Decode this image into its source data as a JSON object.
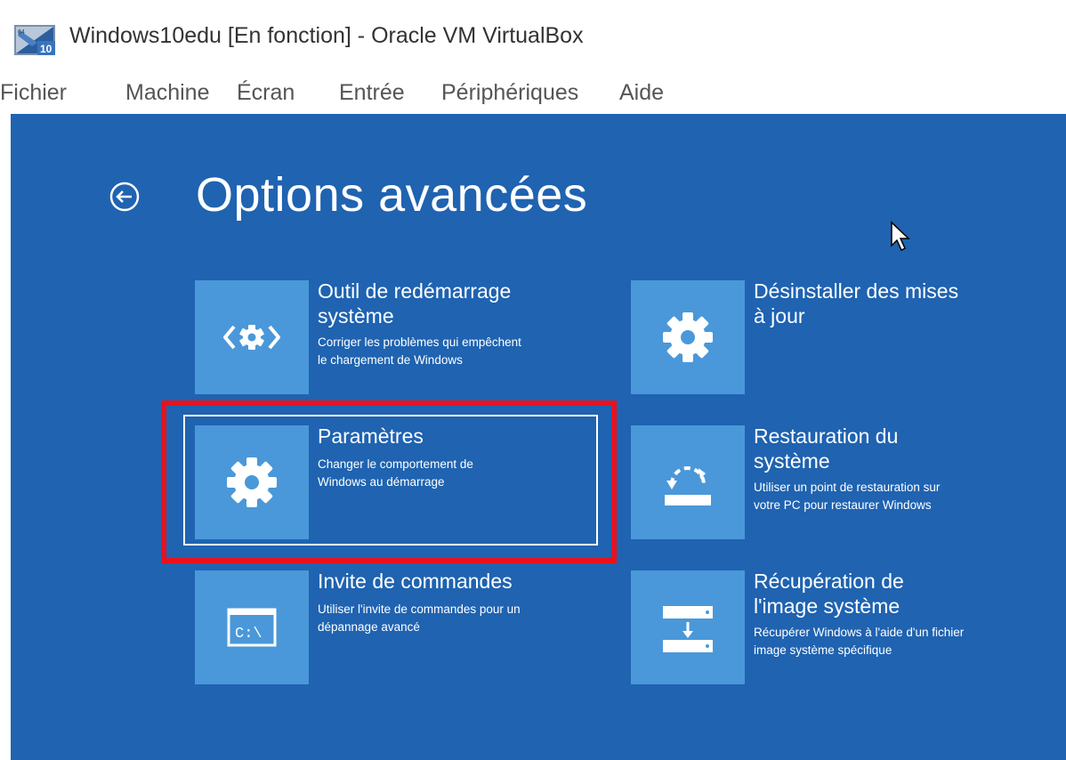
{
  "window": {
    "title": "Windows10edu [En fonction] - Oracle VM VirtualBox",
    "icon": "virtualbox-windows10-icon"
  },
  "menu": {
    "items": [
      "Fichier",
      "Machine",
      "Écran",
      "Entrée",
      "Périphériques",
      "Aide"
    ]
  },
  "screen": {
    "title": "Options avancées",
    "back_icon": "back-arrow-circle-icon",
    "tiles": [
      {
        "title_line1": "Outil de redémarrage",
        "title_line2": "système",
        "desc_line1": "Corriger les problèmes qui empêchent",
        "desc_line2": "le chargement de Windows",
        "icon": "startup-repair-icon"
      },
      {
        "title_line1": "Désinstaller des mises",
        "title_line2": "à jour",
        "desc_line1": "",
        "desc_line2": "",
        "icon": "gear-icon"
      },
      {
        "title_line1": "Paramètres",
        "title_line2": "",
        "desc_line1": "Changer le comportement de",
        "desc_line2": "Windows au démarrage",
        "icon": "gear-icon"
      },
      {
        "title_line1": "Restauration du",
        "title_line2": "système",
        "desc_line1": "Utiliser un point de restauration sur",
        "desc_line2": "votre PC pour restaurer Windows",
        "icon": "system-restore-icon"
      },
      {
        "title_line1": "Invite de commandes",
        "title_line2": "",
        "desc_line1": "Utiliser l'invite de commandes pour un",
        "desc_line2": "dépannage avancé",
        "icon": "command-prompt-icon",
        "icon_text": "C:\\"
      },
      {
        "title_line1": "Récupération de",
        "title_line2": "l'image système",
        "desc_line1": "Récupérer Windows à l'aide d'un fichier",
        "desc_line2": "image système spécifique",
        "icon": "system-image-recovery-icon"
      }
    ]
  },
  "colors": {
    "screen_bg": "#1f63b1",
    "tile_icon_bg": "#4a98d9",
    "highlight": "#e8121d"
  }
}
